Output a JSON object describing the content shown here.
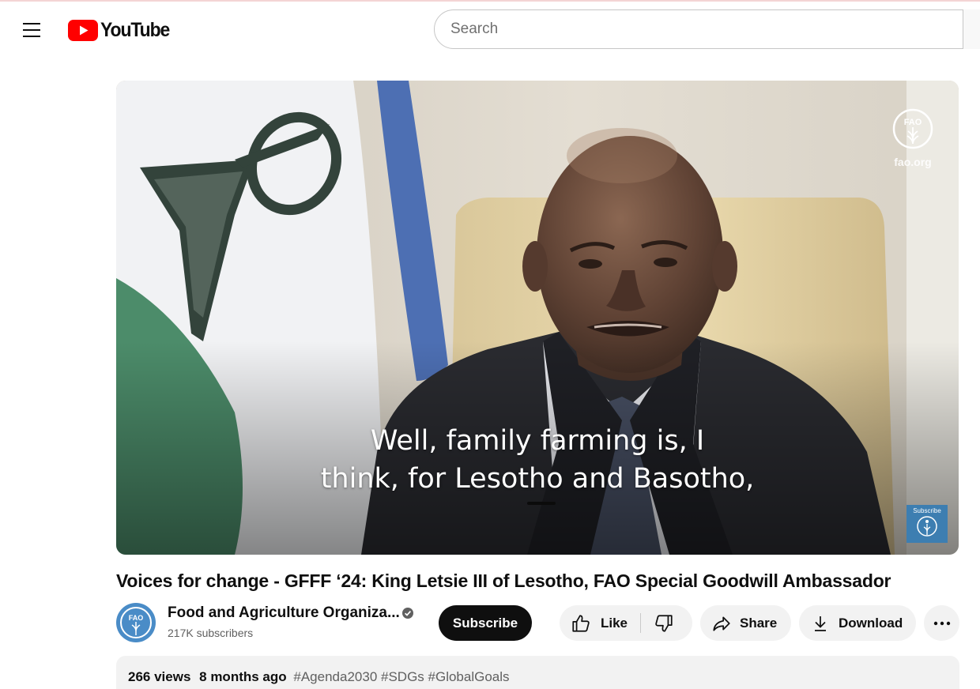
{
  "masthead": {
    "logo_text": "YouTube",
    "search_placeholder": "Search"
  },
  "player": {
    "caption_line1": "Well, family farming is, I",
    "caption_line2": "think, for Lesotho and Basotho,",
    "watermark_url": "fao.org",
    "watermark_logo_text": "FAO",
    "subscribe_badge_text": "Subscribe"
  },
  "video": {
    "title": "Voices for change - GFFF ‘24: King Letsie III of Lesotho, FAO Special Goodwill Ambassador"
  },
  "owner": {
    "channel_name": "Food and Agriculture Organiza...",
    "subscribers": "217K subscribers",
    "subscribe_label": "Subscribe",
    "avatar_text": "FAO"
  },
  "actions": {
    "like_label": "Like",
    "share_label": "Share",
    "download_label": "Download"
  },
  "description": {
    "views": "266 views",
    "date": "8 months ago",
    "hashtags": "#Agenda2030 #SDGs #GlobalGoals"
  },
  "colors": {
    "brand_red": "#ff0000",
    "subscribe_bg": "#0f0f0f",
    "pill_bg": "#f2f2f2",
    "fao_blue": "#4a8cc7"
  },
  "icons": [
    "menu-icon",
    "youtube-logo-icon",
    "verified-icon",
    "thumbs-up-icon",
    "thumbs-down-icon",
    "share-icon",
    "download-icon",
    "more-horizontal-icon",
    "fao-logo-icon"
  ]
}
